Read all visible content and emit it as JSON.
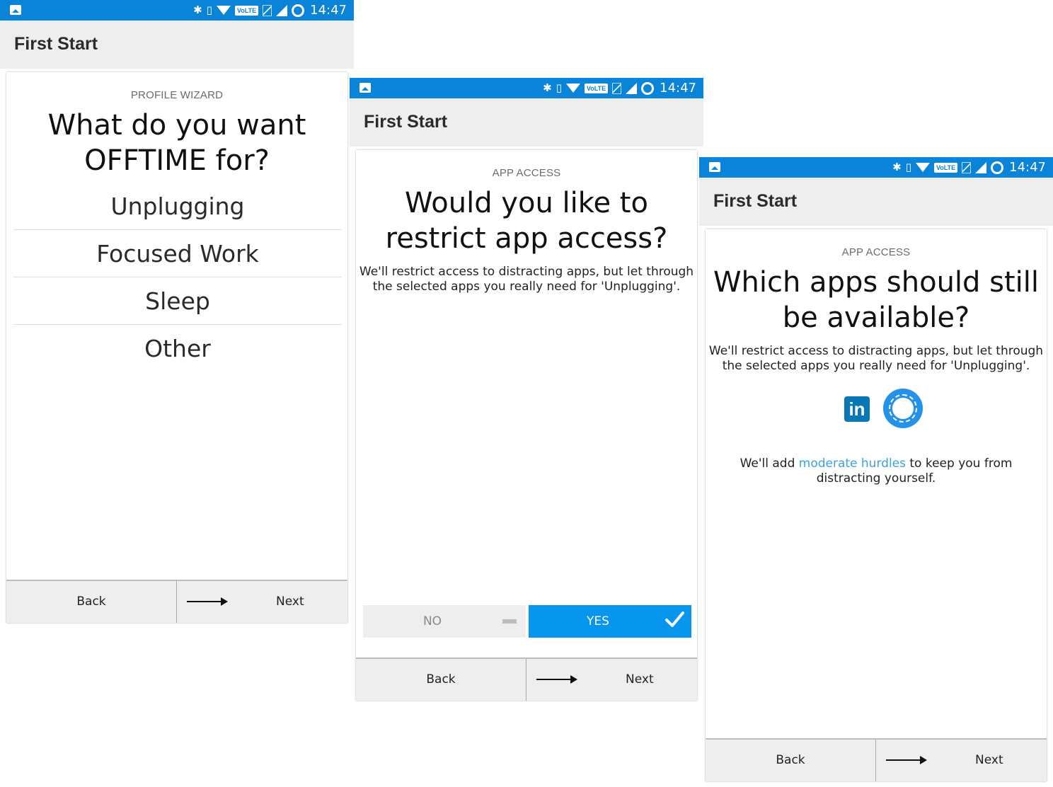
{
  "status_bar": {
    "time": "14:47",
    "volte": "VoLTE"
  },
  "app_title": "First Start",
  "colors": {
    "accent": "#0696ee",
    "status_bar": "#0a84d8",
    "link": "#3ba2e0",
    "app_bar": "#eeeeee"
  },
  "footer": {
    "back_label": "Back",
    "next_label": "Next"
  },
  "screens": [
    {
      "kicker": "PROFILE WIZARD",
      "question_line1": "What do you want",
      "question_line2": "OFFTIME for?",
      "options": [
        "Unplugging",
        "Focused Work",
        "Sleep",
        "Other"
      ]
    },
    {
      "kicker": "APP ACCESS",
      "question_line1": "Would you like to",
      "question_line2": "restrict app access?",
      "description_line1": "We'll restrict access to distracting apps, but let through",
      "description_line2": "the selected apps you really need for 'Unplugging'.",
      "toggle": {
        "no_label": "NO",
        "yes_label": "YES",
        "selected": "YES"
      }
    },
    {
      "kicker": "APP ACCESS",
      "question_line1": "Which apps should still",
      "question_line2": "be available?",
      "description_line1": "We'll restrict access to distracting apps, but let through",
      "description_line2": "the selected apps you really need for 'Unplugging'.",
      "apps": [
        {
          "icon": "linkedin-icon",
          "glyph": "in"
        },
        {
          "icon": "signal-icon"
        }
      ],
      "hurdle_pre": "We'll add ",
      "hurdle_link": "moderate hurdles",
      "hurdle_post": " to keep you from",
      "hurdle_line2": "distracting yourself."
    }
  ]
}
